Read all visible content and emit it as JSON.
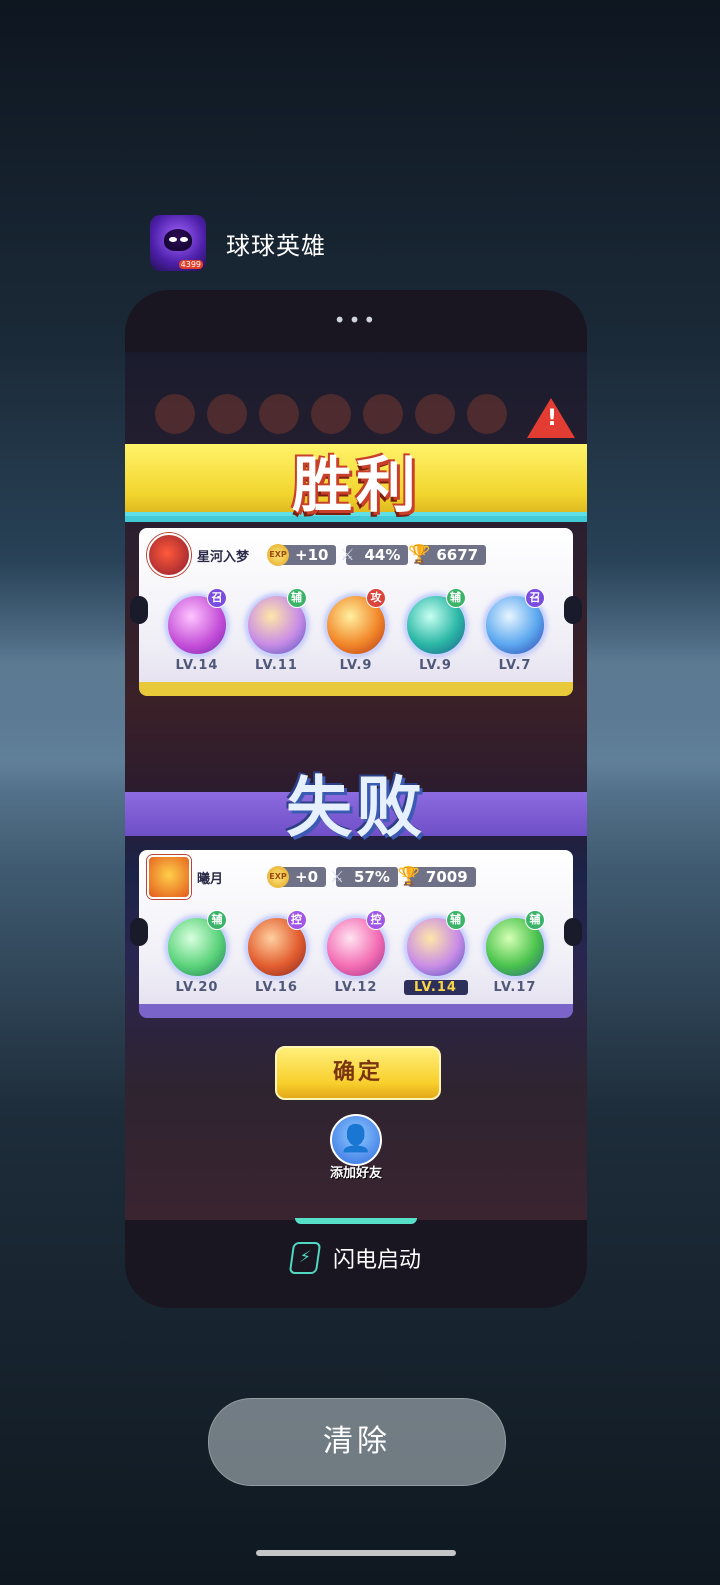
{
  "app": {
    "title": "球球英雄",
    "icon_badge": "4399"
  },
  "card": {
    "menu_dots": "•••",
    "warning_icon": "!",
    "victory": {
      "title": "胜利",
      "player": "星河入梦",
      "exp": "+10",
      "win_rate": "44%",
      "trophies": "6677",
      "heroes": [
        {
          "tag": "召",
          "level": "LV.14"
        },
        {
          "tag": "辅",
          "level": "LV.11"
        },
        {
          "tag": "攻",
          "level": "LV.9"
        },
        {
          "tag": "辅",
          "level": "LV.9"
        },
        {
          "tag": "召",
          "level": "LV.7"
        }
      ]
    },
    "defeat": {
      "title": "失败",
      "player": "曦月",
      "exp": "+0",
      "win_rate": "57%",
      "trophies": "7009",
      "heroes": [
        {
          "tag": "辅",
          "level": "LV.20"
        },
        {
          "tag": "控",
          "level": "LV.16"
        },
        {
          "tag": "控",
          "level": "LV.12"
        },
        {
          "tag": "辅",
          "level": "LV.14"
        },
        {
          "tag": "辅",
          "level": "LV.17"
        }
      ]
    },
    "confirm_label": "确定",
    "add_friend_label": "添加好友",
    "flash_launch_label": "闪电启动"
  },
  "clear_label": "清除",
  "colors": {
    "accent_teal": "#4fd9c2",
    "victory_yellow": "#f2d52e",
    "defeat_purple": "#6f4fc7"
  }
}
